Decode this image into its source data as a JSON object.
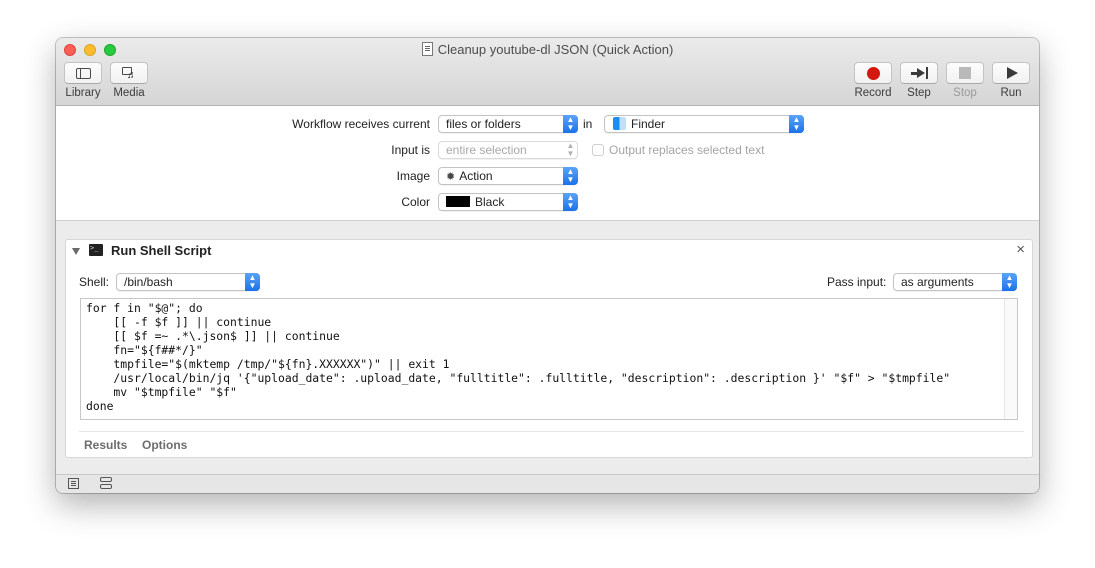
{
  "window": {
    "title": "Cleanup youtube-dl JSON (Quick Action)"
  },
  "toolbar": {
    "library_label": "Library",
    "media_label": "Media",
    "record_label": "Record",
    "step_label": "Step",
    "stop_label": "Stop",
    "run_label": "Run"
  },
  "workflow": {
    "receives_label": "Workflow receives current",
    "receives_value": "files or folders",
    "in_label": "in",
    "in_value": "Finder",
    "input_is_label": "Input is",
    "input_is_value": "entire selection",
    "replaces_label": "Output replaces selected text",
    "image_label": "Image",
    "image_value": "Action",
    "color_label": "Color",
    "color_value": "Black"
  },
  "action": {
    "title": "Run Shell Script",
    "shell_label": "Shell:",
    "shell_value": "/bin/bash",
    "pass_input_label": "Pass input:",
    "pass_input_value": "as arguments",
    "script": "for f in \"$@\"; do\n    [[ -f $f ]] || continue\n    [[ $f =~ .*\\.json$ ]] || continue\n    fn=\"${f##*/}\"\n    tmpfile=\"$(mktemp /tmp/\"${fn}.XXXXXX\")\" || exit 1\n    /usr/local/bin/jq '{\"upload_date\": .upload_date, \"fulltitle\": .fulltitle, \"description\": .description }' \"$f\" > \"$tmpfile\"\n    mv \"$tmpfile\" \"$f\"\ndone",
    "tab_results": "Results",
    "tab_options": "Options"
  },
  "icons": {
    "close": "close-icon",
    "library": "library-icon",
    "media": "media-icon",
    "record": "record-icon",
    "step": "step-icon",
    "stop": "stop-icon",
    "run": "run-icon"
  },
  "colors": {
    "accent": "#1b72e8",
    "record": "#d4170f"
  }
}
